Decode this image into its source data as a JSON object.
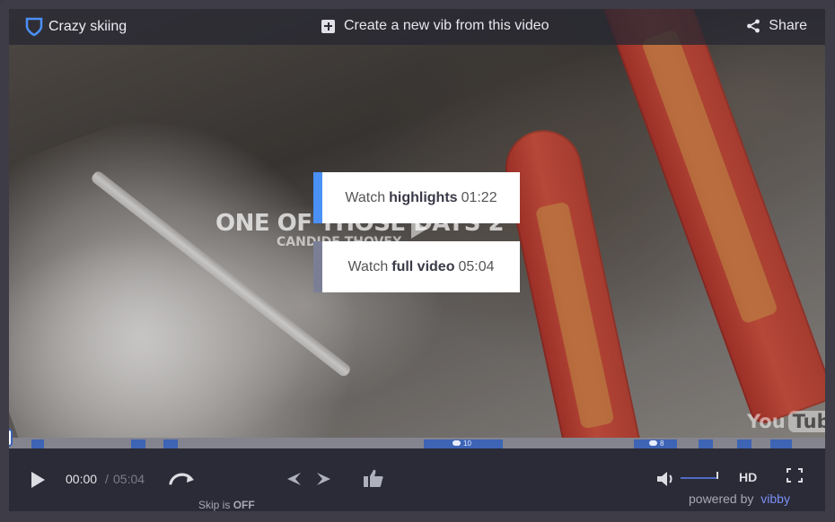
{
  "header": {
    "brand": "Crazy skiing",
    "create_label": "Create a new vib from this video",
    "share_label": "Share"
  },
  "video": {
    "overlay_title": "ONE OF THOSE DAYS 2",
    "overlay_subtitle": "CANDIDE THOVEX",
    "youtube_you": "You",
    "youtube_tube": "Tube"
  },
  "choices": {
    "highlights": {
      "prefix": "Watch",
      "bold": "highlights",
      "time": "01:22"
    },
    "full": {
      "prefix": "Watch",
      "bold": "full video",
      "time": "05:04"
    }
  },
  "timeline": {
    "comments_a": "10",
    "comments_b": "8"
  },
  "controls": {
    "current_time": "00:00",
    "separator": "/",
    "total_time": "05:04",
    "skip_prefix": "Skip is",
    "skip_state": "OFF",
    "hd_label": "HD",
    "powered_prefix": "powered by",
    "powered_brand": "vibby"
  },
  "colors": {
    "accent": "#4a90f5",
    "timeline_segment": "#3d64b5",
    "vibby": "#7c8ef5"
  }
}
